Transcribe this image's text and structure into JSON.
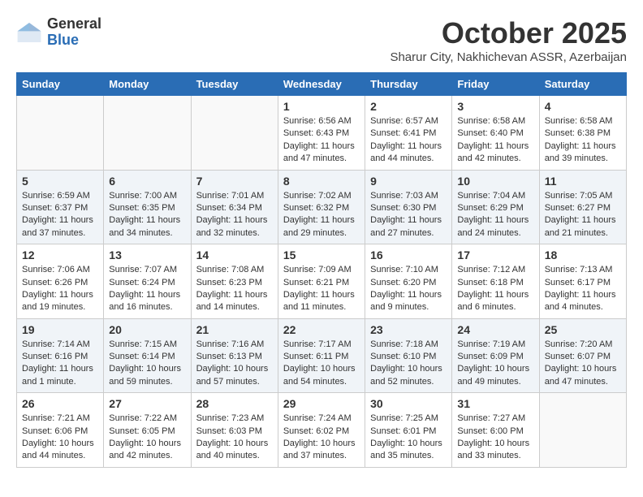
{
  "logo": {
    "general": "General",
    "blue": "Blue"
  },
  "title": "October 2025",
  "location": "Sharur City, Nakhichevan ASSR, Azerbaijan",
  "days_header": [
    "Sunday",
    "Monday",
    "Tuesday",
    "Wednesday",
    "Thursday",
    "Friday",
    "Saturday"
  ],
  "weeks": [
    [
      {
        "day": "",
        "info": ""
      },
      {
        "day": "",
        "info": ""
      },
      {
        "day": "",
        "info": ""
      },
      {
        "day": "1",
        "info": "Sunrise: 6:56 AM\nSunset: 6:43 PM\nDaylight: 11 hours\nand 47 minutes."
      },
      {
        "day": "2",
        "info": "Sunrise: 6:57 AM\nSunset: 6:41 PM\nDaylight: 11 hours\nand 44 minutes."
      },
      {
        "day": "3",
        "info": "Sunrise: 6:58 AM\nSunset: 6:40 PM\nDaylight: 11 hours\nand 42 minutes."
      },
      {
        "day": "4",
        "info": "Sunrise: 6:58 AM\nSunset: 6:38 PM\nDaylight: 11 hours\nand 39 minutes."
      }
    ],
    [
      {
        "day": "5",
        "info": "Sunrise: 6:59 AM\nSunset: 6:37 PM\nDaylight: 11 hours\nand 37 minutes."
      },
      {
        "day": "6",
        "info": "Sunrise: 7:00 AM\nSunset: 6:35 PM\nDaylight: 11 hours\nand 34 minutes."
      },
      {
        "day": "7",
        "info": "Sunrise: 7:01 AM\nSunset: 6:34 PM\nDaylight: 11 hours\nand 32 minutes."
      },
      {
        "day": "8",
        "info": "Sunrise: 7:02 AM\nSunset: 6:32 PM\nDaylight: 11 hours\nand 29 minutes."
      },
      {
        "day": "9",
        "info": "Sunrise: 7:03 AM\nSunset: 6:30 PM\nDaylight: 11 hours\nand 27 minutes."
      },
      {
        "day": "10",
        "info": "Sunrise: 7:04 AM\nSunset: 6:29 PM\nDaylight: 11 hours\nand 24 minutes."
      },
      {
        "day": "11",
        "info": "Sunrise: 7:05 AM\nSunset: 6:27 PM\nDaylight: 11 hours\nand 21 minutes."
      }
    ],
    [
      {
        "day": "12",
        "info": "Sunrise: 7:06 AM\nSunset: 6:26 PM\nDaylight: 11 hours\nand 19 minutes."
      },
      {
        "day": "13",
        "info": "Sunrise: 7:07 AM\nSunset: 6:24 PM\nDaylight: 11 hours\nand 16 minutes."
      },
      {
        "day": "14",
        "info": "Sunrise: 7:08 AM\nSunset: 6:23 PM\nDaylight: 11 hours\nand 14 minutes."
      },
      {
        "day": "15",
        "info": "Sunrise: 7:09 AM\nSunset: 6:21 PM\nDaylight: 11 hours\nand 11 minutes."
      },
      {
        "day": "16",
        "info": "Sunrise: 7:10 AM\nSunset: 6:20 PM\nDaylight: 11 hours\nand 9 minutes."
      },
      {
        "day": "17",
        "info": "Sunrise: 7:12 AM\nSunset: 6:18 PM\nDaylight: 11 hours\nand 6 minutes."
      },
      {
        "day": "18",
        "info": "Sunrise: 7:13 AM\nSunset: 6:17 PM\nDaylight: 11 hours\nand 4 minutes."
      }
    ],
    [
      {
        "day": "19",
        "info": "Sunrise: 7:14 AM\nSunset: 6:16 PM\nDaylight: 11 hours\nand 1 minute."
      },
      {
        "day": "20",
        "info": "Sunrise: 7:15 AM\nSunset: 6:14 PM\nDaylight: 10 hours\nand 59 minutes."
      },
      {
        "day": "21",
        "info": "Sunrise: 7:16 AM\nSunset: 6:13 PM\nDaylight: 10 hours\nand 57 minutes."
      },
      {
        "day": "22",
        "info": "Sunrise: 7:17 AM\nSunset: 6:11 PM\nDaylight: 10 hours\nand 54 minutes."
      },
      {
        "day": "23",
        "info": "Sunrise: 7:18 AM\nSunset: 6:10 PM\nDaylight: 10 hours\nand 52 minutes."
      },
      {
        "day": "24",
        "info": "Sunrise: 7:19 AM\nSunset: 6:09 PM\nDaylight: 10 hours\nand 49 minutes."
      },
      {
        "day": "25",
        "info": "Sunrise: 7:20 AM\nSunset: 6:07 PM\nDaylight: 10 hours\nand 47 minutes."
      }
    ],
    [
      {
        "day": "26",
        "info": "Sunrise: 7:21 AM\nSunset: 6:06 PM\nDaylight: 10 hours\nand 44 minutes."
      },
      {
        "day": "27",
        "info": "Sunrise: 7:22 AM\nSunset: 6:05 PM\nDaylight: 10 hours\nand 42 minutes."
      },
      {
        "day": "28",
        "info": "Sunrise: 7:23 AM\nSunset: 6:03 PM\nDaylight: 10 hours\nand 40 minutes."
      },
      {
        "day": "29",
        "info": "Sunrise: 7:24 AM\nSunset: 6:02 PM\nDaylight: 10 hours\nand 37 minutes."
      },
      {
        "day": "30",
        "info": "Sunrise: 7:25 AM\nSunset: 6:01 PM\nDaylight: 10 hours\nand 35 minutes."
      },
      {
        "day": "31",
        "info": "Sunrise: 7:27 AM\nSunset: 6:00 PM\nDaylight: 10 hours\nand 33 minutes."
      },
      {
        "day": "",
        "info": ""
      }
    ]
  ]
}
